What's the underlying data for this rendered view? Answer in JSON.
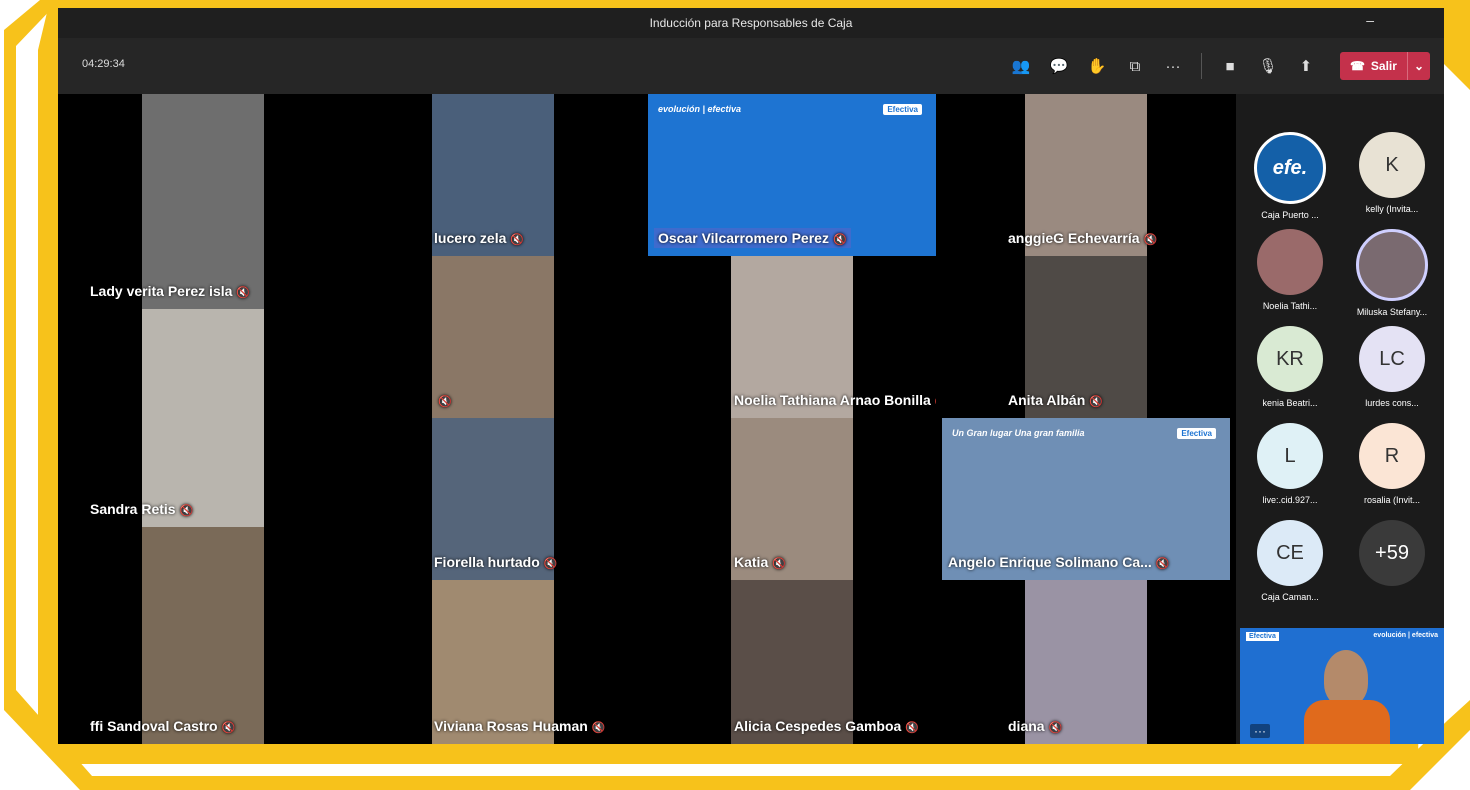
{
  "window": {
    "title": "Inducción para Responsables de Caja",
    "minimize_glyph": "–"
  },
  "controls": {
    "timer": "04:29:34",
    "icons": [
      {
        "name": "people-icon",
        "glyph": "👥"
      },
      {
        "name": "chat-icon",
        "glyph": "💬"
      },
      {
        "name": "raise-hand-icon",
        "glyph": "✋"
      },
      {
        "name": "rooms-icon",
        "glyph": "⧉"
      },
      {
        "name": "more-icon",
        "glyph": "···"
      }
    ],
    "camera_glyph": "■",
    "mic_glyph": "🎙",
    "share_glyph": "⬆",
    "leave": {
      "label": "Salir",
      "phone_glyph": "☎",
      "caret_glyph": "⌄"
    }
  },
  "tiles": [
    {
      "label": "Lady verita Perez isla",
      "bg": "#6e6e6e"
    },
    {
      "label": "Sandra Retis",
      "bg": "#b9b5ae"
    },
    {
      "label": "ffi Sandoval Castro",
      "bg": "#7a6a58"
    },
    {
      "label": "lucero zela",
      "bg": "#4a5f7a"
    },
    {
      "label": "",
      "bg": "#8a7766"
    },
    {
      "label": "Fiorella hurtado",
      "bg": "#55657a"
    },
    {
      "label": "Viviana Rosas Huaman",
      "bg": "#a08a70"
    },
    {
      "label": "Oscar Vilcarromero Perez",
      "bg": "#1e74d2",
      "banner": "evolución | efectiva",
      "logo": "Efectiva"
    },
    {
      "label": "Noelia Tathiana Arnao Bonilla",
      "bg": "#b3a8a0"
    },
    {
      "label": "Katia",
      "bg": "#9b8b7e"
    },
    {
      "label": "Alicia Cespedes Gamboa",
      "bg": "#5a4e48"
    },
    {
      "label": "anggieG Echevarría",
      "bg": "#9a8a80"
    },
    {
      "label": "Anita Albán",
      "bg": "#4f4a46"
    },
    {
      "label": "Angelo Enrique Solimano Ca...",
      "bg": "#6f8fb5",
      "banner": "Un Gran lugar Una gran familia",
      "logo": "Efectiva"
    },
    {
      "label": "diana",
      "bg": "#9a93a4"
    }
  ],
  "mic_glyph": "🔇",
  "roster": [
    {
      "initials": "efe.",
      "name": "Caja Puerto ...",
      "color": "#1460a8",
      "fg": "#ffffff"
    },
    {
      "initials": "K",
      "name": "kelly (Invita...",
      "color": "#e8e2d4",
      "fg": "#333333"
    },
    {
      "initials": "",
      "name": "Noelia Tathi...",
      "color": "#9a6a6a",
      "fg": "#ffffff"
    },
    {
      "initials": "",
      "name": "Miluska Stefany...",
      "color": "#7a6a70",
      "fg": "#ffffff"
    },
    {
      "initials": "KR",
      "name": "kenia Beatri...",
      "color": "#d9ead3",
      "fg": "#333333"
    },
    {
      "initials": "LC",
      "name": "lurdes cons...",
      "color": "#e4e2f4",
      "fg": "#333333"
    },
    {
      "initials": "L",
      "name": "live:.cid.927...",
      "color": "#dff1f6",
      "fg": "#333333"
    },
    {
      "initials": "R",
      "name": "rosalia (Invit...",
      "color": "#fbe5d5",
      "fg": "#333333"
    },
    {
      "initials": "CE",
      "name": "Caja Caman...",
      "color": "#dceaf7",
      "fg": "#333333"
    },
    {
      "initials": "+59",
      "name": "",
      "color": "#3a3a3a",
      "fg": "#ffffff"
    }
  ],
  "pip": {
    "banner": "evolución | efectiva",
    "logo": "Efectiva",
    "more_glyph": "···"
  }
}
